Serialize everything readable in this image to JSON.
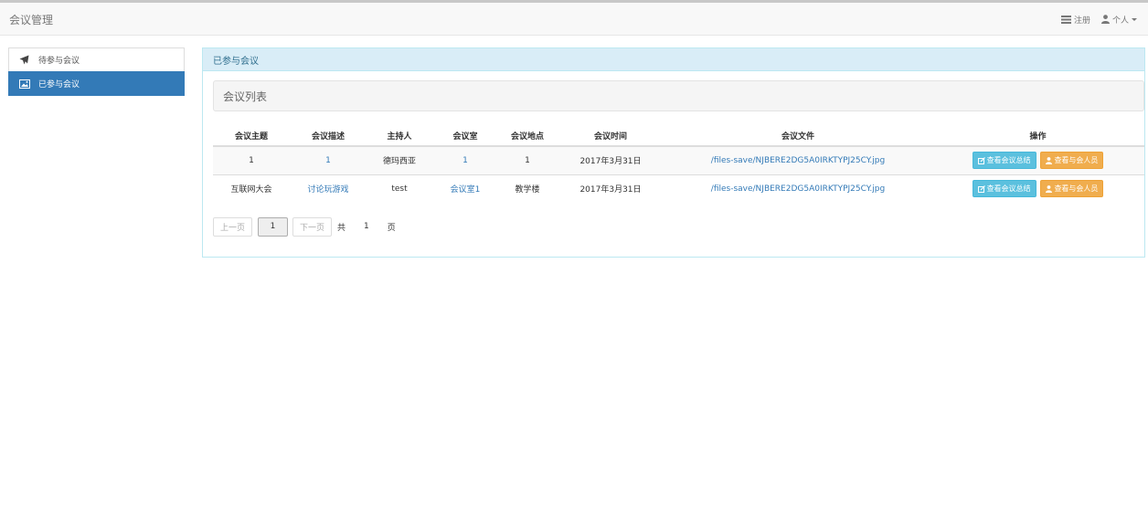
{
  "app": {
    "title": "会议管理"
  },
  "nav": {
    "register_label": "注册",
    "personal_label": "个人"
  },
  "sidebar": {
    "items": [
      {
        "label": "待参与会议",
        "icon": "plane-icon",
        "active": false
      },
      {
        "label": "已参与会议",
        "icon": "image-icon",
        "active": true
      }
    ]
  },
  "panel": {
    "title": "已参与会议",
    "subtitle": "会议列表"
  },
  "table": {
    "headers": [
      "会议主题",
      "会议描述",
      "主持人",
      "会议室",
      "会议地点",
      "会议时间",
      "会议文件",
      "操作"
    ],
    "rows": [
      {
        "topic": "1",
        "description": "1",
        "host": "德玛西亚",
        "room": "1",
        "location": "1",
        "time": "2017年3月31日",
        "file": "/files-save/NJBERE2DG5A0IRKTYPJ25CY.jpg"
      },
      {
        "topic": "互联网大会",
        "description": "讨论玩游戏",
        "host": "test",
        "room": "会议室1",
        "location": "教学楼",
        "time": "2017年3月31日",
        "file": "/files-save/NJBERE2DG5A0IRKTYPJ25CY.jpg"
      }
    ],
    "actions": {
      "summary_label": "查看会议总结",
      "attendees_label": "查看与会人员"
    }
  },
  "pager": {
    "prev_label": "上一页",
    "current_page": "1",
    "next_label": "下一页",
    "total_prefix": "共",
    "total_pages": "1",
    "total_suffix": "页"
  },
  "colors": {
    "primary": "#337ab7",
    "info": "#5bc0de",
    "warning": "#f0ad4e",
    "panel_heading_bg": "#d9edf7"
  }
}
